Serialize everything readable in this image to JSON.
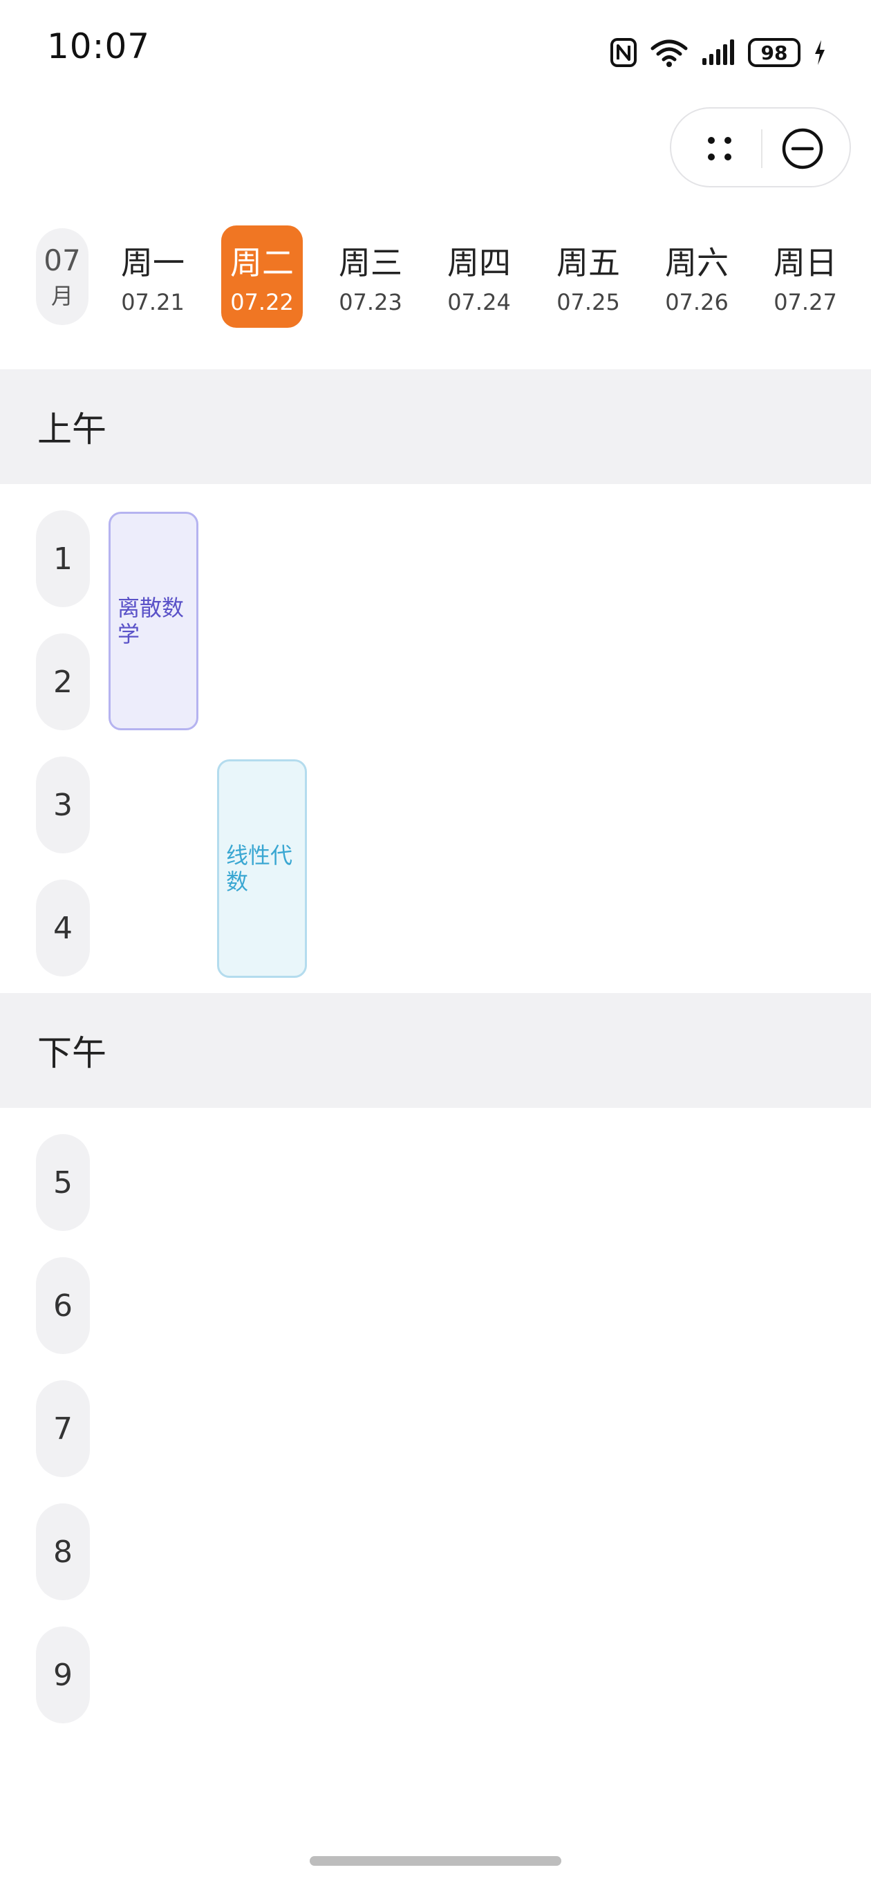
{
  "status_bar": {
    "time": "10:07",
    "battery": "98"
  },
  "capsule": {
    "more_icon": "more-dots-icon",
    "close_icon": "minus-circle-icon"
  },
  "week": {
    "month_number": "07",
    "month_label": "月",
    "days": [
      {
        "name": "周一",
        "date": "07.21"
      },
      {
        "name": "周二",
        "date": "07.22"
      },
      {
        "name": "周三",
        "date": "07.23"
      },
      {
        "name": "周四",
        "date": "07.24"
      },
      {
        "name": "周五",
        "date": "07.25"
      },
      {
        "name": "周六",
        "date": "07.26"
      },
      {
        "name": "周日",
        "date": "07.27"
      }
    ],
    "active_day": "周二",
    "accent_color": "#f07623"
  },
  "sections": {
    "morning": "上午",
    "afternoon": "下午"
  },
  "periods": [
    "1",
    "2",
    "3",
    "4",
    "5",
    "6",
    "7",
    "8",
    "9"
  ],
  "courses": [
    {
      "name": "离散数学",
      "line1": "离散数",
      "line2": "学",
      "day": "周一",
      "periods": "1-2",
      "color": "#5a52c8"
    },
    {
      "name": "线性代数",
      "line1": "线性代",
      "line2": "数",
      "day": "周二",
      "periods": "3-4",
      "color": "#3aa7d2"
    }
  ]
}
